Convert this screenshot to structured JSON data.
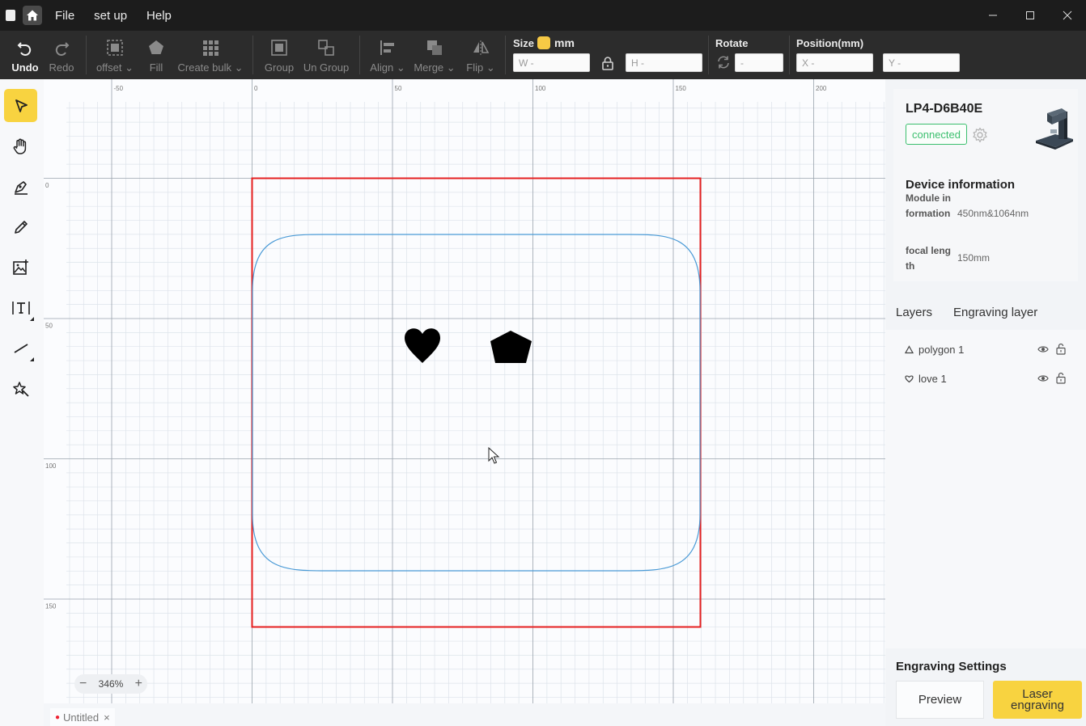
{
  "titlebar": {
    "menus": [
      "File",
      "set up",
      "Help"
    ]
  },
  "toolbar": {
    "undo": "Undo",
    "redo": "Redo",
    "offset": "offset",
    "fill": "Fill",
    "create_bulk": "Create bulk",
    "group": "Group",
    "ungroup": "Un Group",
    "align": "Align",
    "merge": "Merge",
    "flip": "Flip",
    "size_label": "Size",
    "unit": "mm",
    "w_placeholder": "W -",
    "h_placeholder": "H -",
    "rotate_label": "Rotate",
    "rotate_placeholder": "-",
    "position_label": "Position(mm)",
    "x_placeholder": "X -",
    "y_placeholder": "Y -"
  },
  "left_tools": [
    "select-icon",
    "hand-icon",
    "pen-icon",
    "pencil-icon",
    "image-icon",
    "text-icon",
    "line-icon",
    "magic-icon"
  ],
  "canvas": {
    "ruler_top": [
      "-50",
      "0",
      "50",
      "100",
      "150",
      "200"
    ],
    "ruler_left": [
      "0",
      "50",
      "100",
      "150"
    ],
    "zoom": "346%",
    "frame_color": "#e52020",
    "shape_color": "#4a9ad6"
  },
  "doc_tab": {
    "title": "Untitled",
    "close": "×"
  },
  "device": {
    "name": "LP4-D6B40E",
    "status": "connected",
    "info_title": "Device information",
    "module_label": "Module information",
    "module_value": "450nm&1064nm",
    "focal_label": "focal length",
    "focal_value": "150mm"
  },
  "tabs": {
    "layers": "Layers",
    "engraving_layer": "Engraving layer"
  },
  "layers": [
    {
      "name": "polygon 1",
      "icon": "triangle-icon"
    },
    {
      "name": "love 1",
      "icon": "heart-icon"
    }
  ],
  "engraving": {
    "title": "Engraving Settings",
    "preview": "Preview",
    "laser": "Laser engraving"
  }
}
